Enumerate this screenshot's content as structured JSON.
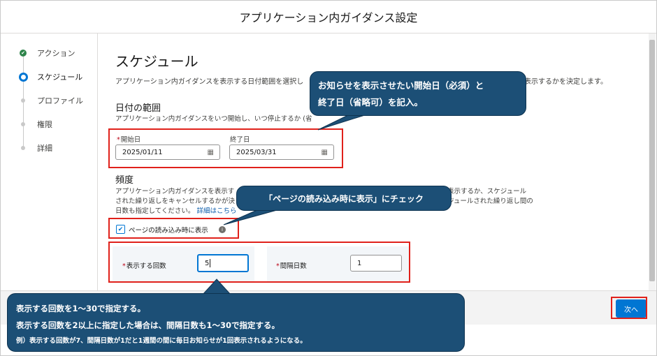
{
  "header": {
    "title": "アプリケーション内ガイダンス設定"
  },
  "steps": [
    {
      "label": "アクション",
      "state": "done"
    },
    {
      "label": "スケジュール",
      "state": "current"
    },
    {
      "label": "プロファイル",
      "state": "pending"
    },
    {
      "label": "権限",
      "state": "pending"
    },
    {
      "label": "詳細",
      "state": "pending"
    }
  ],
  "main": {
    "title": "スケジュール",
    "description_left": "アプリケーション内ガイダンスを表示する日付範囲を選択し",
    "description_right": "返し表示するかを決定します。",
    "date_range": {
      "title": "日付の範囲",
      "description": "アプリケーション内ガイダンスをいつ開始し、いつ停止するか (省",
      "start_label": "開始日",
      "start_value": "2025/01/11",
      "end_label": "終了日",
      "end_value": "2025/03/31"
    },
    "frequency": {
      "title": "頻度",
      "line1": "アプリケーション内ガイダンスを表示す",
      "line1_right": "表示するか、スケジュール",
      "line2": "された繰り返しをキャンセルするかが決",
      "line2_right": "ジュールされた繰り返し間の",
      "line3": "日数も指定してください。",
      "link": "詳細はこちら",
      "checkbox_label": "ページの読み込み時に表示",
      "checkbox_checked": true,
      "count_label": "表示する回数",
      "count_value": "5",
      "interval_label": "間隔日数",
      "interval_value": "1"
    }
  },
  "footer": {
    "next_label": "次へ"
  },
  "callouts": {
    "dates": [
      "お知らせを表示させたい開始日（必須）と",
      "終了日（省略可）を記入。"
    ],
    "checkbox": "「ページの読み込み時に表示」にチェック",
    "count": [
      "表示する回数を1～30で指定する。",
      "表示する回数を2以上に指定した場合は、間隔日数も1～30で指定する。",
      "例）表示する回数が7、間隔日数が1だと1週間の間に毎日お知らせが1回表示されるようになる。"
    ]
  },
  "colors": {
    "accent": "#0176d3",
    "done": "#2e844a",
    "annotation_red": "#e0211b",
    "callout_bg": "#1c4f76"
  },
  "icons": [
    "check-icon",
    "calendar-icon",
    "info-icon"
  ]
}
